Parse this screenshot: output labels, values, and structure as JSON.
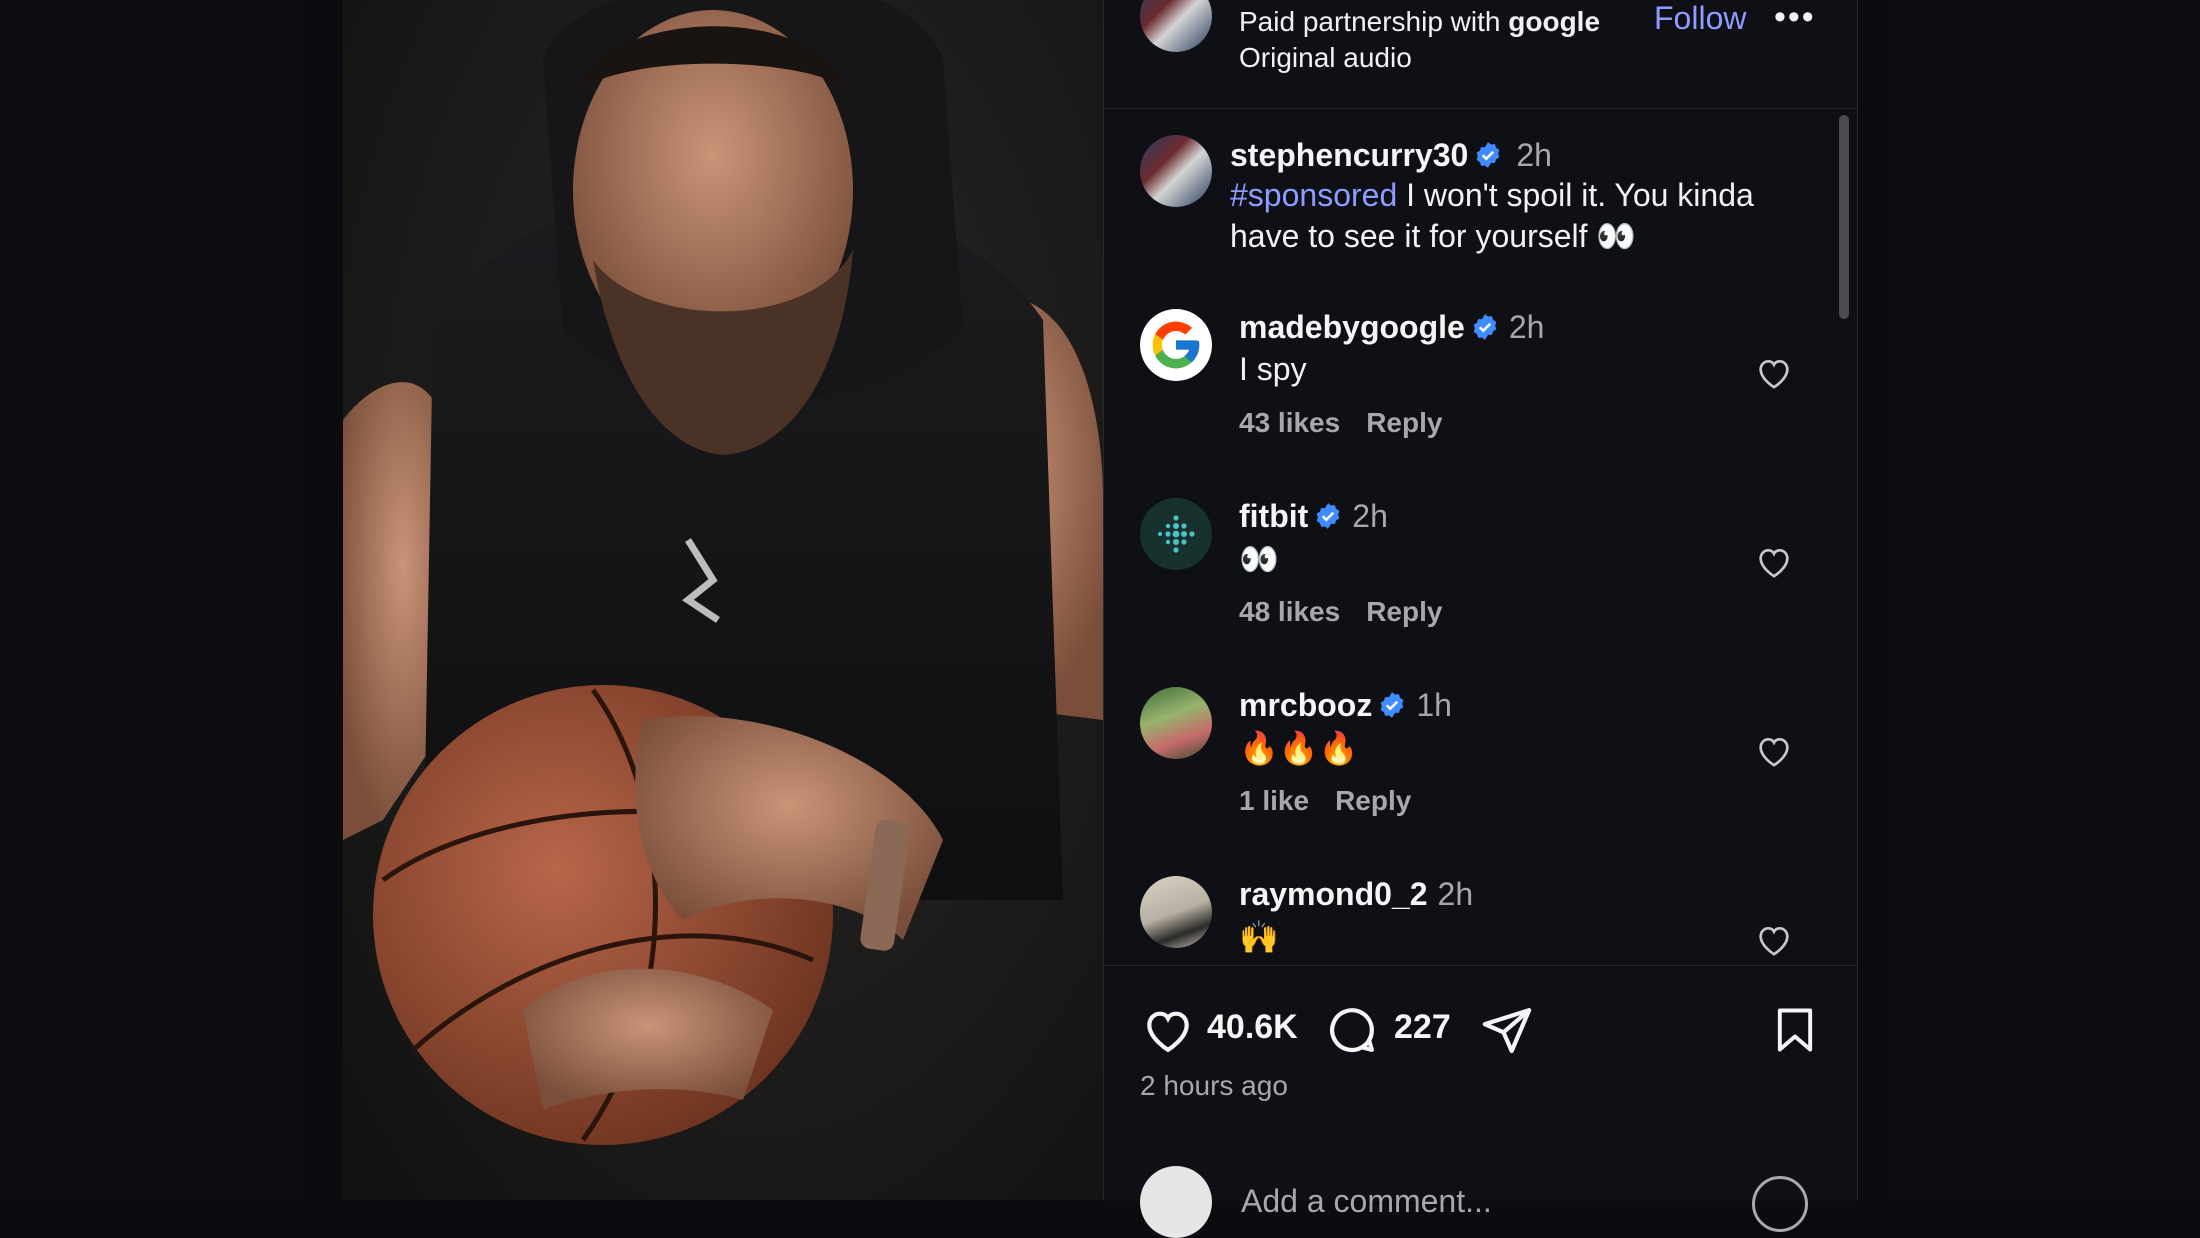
{
  "post": {
    "header": {
      "partnership_prefix": "Paid partnership with ",
      "partner": "google",
      "audio": "Original audio",
      "follow_label": "Follow",
      "more_label": "•••"
    },
    "caption": {
      "username": "stephencurry30",
      "time": "2h",
      "hashtag": "#sponsored",
      "text": " I won't spoil it. You kinda have to see it for yourself 👀"
    },
    "comments": [
      {
        "username": "madebygoogle",
        "verified": true,
        "time": "2h",
        "text": "I spy",
        "likes": "43 likes",
        "reply": "Reply"
      },
      {
        "username": "fitbit",
        "verified": true,
        "time": "2h",
        "text": "👀",
        "likes": "48 likes",
        "reply": "Reply"
      },
      {
        "username": "mrcbooz",
        "verified": true,
        "time": "1h",
        "text": "🔥🔥🔥",
        "likes": "1 like",
        "reply": "Reply"
      },
      {
        "username": "raymond0_2",
        "verified": false,
        "time": "2h",
        "text": "🙌",
        "likes": "",
        "reply": ""
      }
    ],
    "actions": {
      "like_count": "40.6K",
      "comment_count": "227",
      "timestamp": "2 hours ago"
    },
    "add_comment": {
      "placeholder": "Add a comment..."
    }
  },
  "colors": {
    "background": "#0e1015",
    "link": "#8e9bff",
    "verified": "#3f8cff",
    "muted": "#a8a8a8"
  },
  "icons": [
    "verified-badge-icon",
    "heart-icon",
    "comment-icon",
    "share-icon",
    "bookmark-icon",
    "more-icon",
    "google-logo-icon",
    "fitbit-logo-icon",
    "emoji-icon"
  ]
}
